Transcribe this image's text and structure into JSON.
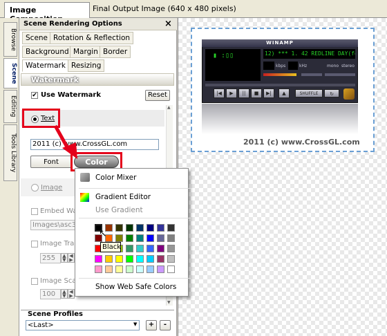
{
  "tabs": {
    "active": "Image Composition",
    "output": "Final Output Image (640 x 480 pixels)"
  },
  "side_tabs": [
    "Browse",
    "Scene",
    "Editing",
    "Tools Library"
  ],
  "panel": {
    "title": "Scene Rendering Options",
    "close": "×",
    "tab_row1": [
      "Scene",
      "Rotation & Reflection"
    ],
    "tab_row2": [
      "Background",
      "Margin",
      "Border"
    ],
    "tab_row3": [
      "Watermark",
      "Resizing"
    ],
    "section_title": "Watermark",
    "use_watermark_label": "Use Watermark",
    "use_watermark_checked": true,
    "reset_label": "Reset",
    "text_radio_label": "Text",
    "text_value": "2011 (c) www.CrossGL.com",
    "font_button": "Font",
    "color_button": "Color",
    "image_radio_label": "Image",
    "embed_label": "Embed Wate",
    "image_path": "Images\\asc300",
    "image_transp_label": "Image Transp",
    "image_transp_value": "255",
    "image_scale_label": "Image Scale",
    "image_scale_value": "100",
    "profiles_label": "Scene Profiles",
    "profiles_value": "<Last>",
    "add_label": "+",
    "remove_label": "-"
  },
  "winamp": {
    "title": "WINAMP",
    "track": "12) *** 1. 42 REDLINE DAY(feat",
    "kbps": "kbps",
    "khz": "kHz",
    "mono": "mono",
    "stereo": "stereo",
    "shuffle": "SHUFFLE"
  },
  "watermark_preview": "2011 (c) www.CrossGL.com",
  "popup": {
    "items": [
      "Color Mixer",
      "Gradient Editor",
      "Use Gradient",
      "Show Web Safe Colors"
    ],
    "tooltip": "Black",
    "swatches": [
      [
        "#000000",
        "#993300",
        "#333300",
        "#003300",
        "#003366",
        "#000080",
        "#333399",
        "#333333"
      ],
      [
        "#800000",
        "#FF6600",
        "#808000",
        "#008000",
        "#008080",
        "#0000FF",
        "#666699",
        "#808080"
      ],
      [
        "#FF0000",
        "#FF9900",
        "#99CC00",
        "#339966",
        "#33CCCC",
        "#3366FF",
        "#800080",
        "#969696"
      ],
      [
        "#FF00FF",
        "#FFCC00",
        "#FFFF00",
        "#00FF00",
        "#00FFFF",
        "#00CCFF",
        "#993366",
        "#C0C0C0"
      ],
      [
        "#FF99CC",
        "#FFCC99",
        "#FFFF99",
        "#CCFFCC",
        "#CCFFFF",
        "#99CCFF",
        "#CC99FF",
        "#FFFFFF"
      ]
    ]
  },
  "colors": {
    "highlight_red": "#e4001b",
    "canvas_border": "#6a9fd4"
  }
}
